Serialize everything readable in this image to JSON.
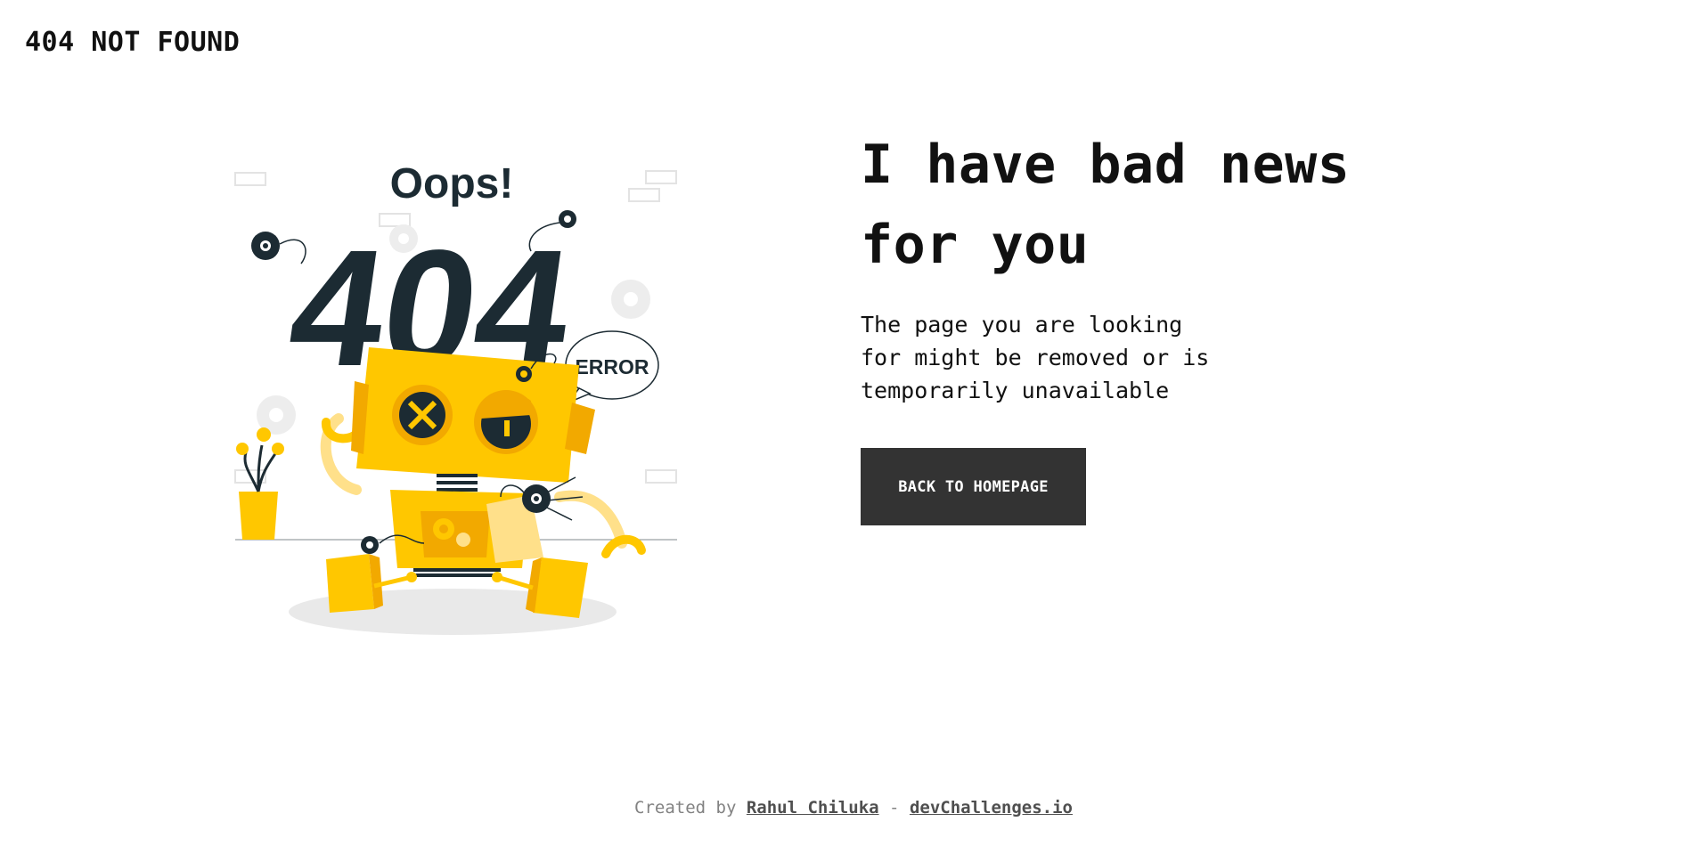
{
  "header": {
    "brand": "404 NOT FOUND"
  },
  "illustration": {
    "oops_text": "Oops!",
    "code_text": "404",
    "bubble_text": "ERROR"
  },
  "main": {
    "headline_line1": "I have bad news",
    "headline_line2": "for you",
    "description": "The page you are looking for might be removed or is temporarily unavailable",
    "button_label": "Back to Homepage"
  },
  "footer": {
    "prefix": "Created by",
    "author": "Rahul Chiluka",
    "separator": "-",
    "site": "devChallenges.io"
  },
  "colors": {
    "accent_yellow": "#FFC700",
    "dark_navy": "#1C2B33",
    "button_bg": "#333333"
  }
}
